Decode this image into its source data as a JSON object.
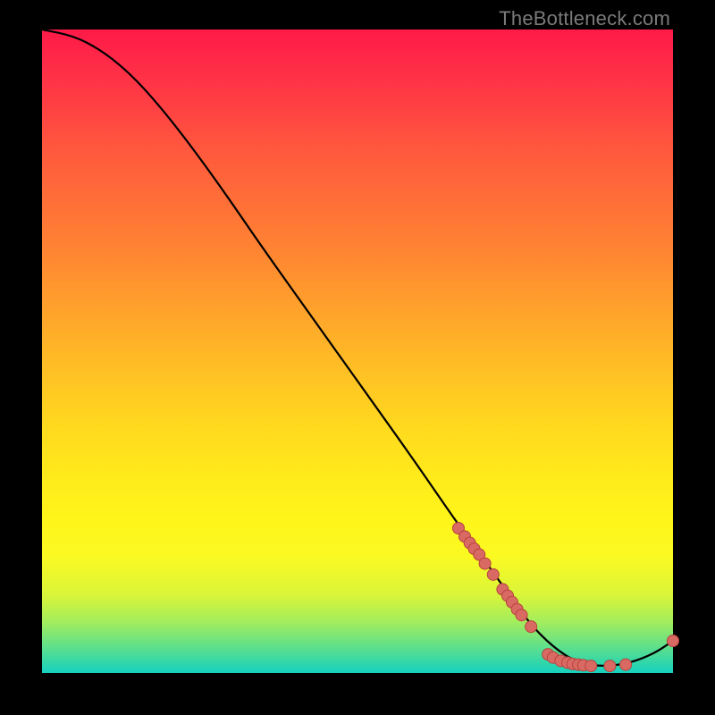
{
  "watermark": "TheBottleneck.com",
  "colors": {
    "dot_fill": "#d96a63",
    "dot_stroke": "#b8423e",
    "line": "#000000"
  },
  "chart_data": {
    "type": "line",
    "title": "",
    "xlabel": "",
    "ylabel": "",
    "xlim": [
      0,
      100
    ],
    "ylim": [
      0,
      100
    ],
    "curve": [
      {
        "x": 0,
        "y": 100
      },
      {
        "x": 5,
        "y": 99
      },
      {
        "x": 9,
        "y": 97
      },
      {
        "x": 13,
        "y": 94
      },
      {
        "x": 17,
        "y": 90
      },
      {
        "x": 22,
        "y": 84
      },
      {
        "x": 28,
        "y": 76
      },
      {
        "x": 35,
        "y": 66
      },
      {
        "x": 43,
        "y": 55
      },
      {
        "x": 51,
        "y": 44
      },
      {
        "x": 59,
        "y": 33
      },
      {
        "x": 66,
        "y": 23
      },
      {
        "x": 72,
        "y": 15
      },
      {
        "x": 77,
        "y": 8
      },
      {
        "x": 81,
        "y": 4
      },
      {
        "x": 85,
        "y": 1.5
      },
      {
        "x": 89,
        "y": 1
      },
      {
        "x": 93,
        "y": 1.5
      },
      {
        "x": 97,
        "y": 3
      },
      {
        "x": 100,
        "y": 5
      }
    ],
    "dots": [
      {
        "x": 66.0,
        "y": 22.5
      },
      {
        "x": 67.0,
        "y": 21.2
      },
      {
        "x": 67.8,
        "y": 20.2
      },
      {
        "x": 68.5,
        "y": 19.3
      },
      {
        "x": 69.3,
        "y": 18.4
      },
      {
        "x": 70.2,
        "y": 17.0
      },
      {
        "x": 71.5,
        "y": 15.3
      },
      {
        "x": 73.0,
        "y": 13.0
      },
      {
        "x": 73.8,
        "y": 12.0
      },
      {
        "x": 74.5,
        "y": 11.0
      },
      {
        "x": 75.3,
        "y": 9.9
      },
      {
        "x": 76.0,
        "y": 9.0
      },
      {
        "x": 77.5,
        "y": 7.2
      },
      {
        "x": 80.2,
        "y": 2.9
      },
      {
        "x": 81.0,
        "y": 2.4
      },
      {
        "x": 82.2,
        "y": 1.9
      },
      {
        "x": 83.3,
        "y": 1.6
      },
      {
        "x": 84.1,
        "y": 1.4
      },
      {
        "x": 85.0,
        "y": 1.3
      },
      {
        "x": 85.8,
        "y": 1.2
      },
      {
        "x": 87.0,
        "y": 1.1
      },
      {
        "x": 90.0,
        "y": 1.1
      },
      {
        "x": 92.5,
        "y": 1.3
      },
      {
        "x": 100.0,
        "y": 5.0
      }
    ],
    "dot_radius": 6.5
  }
}
